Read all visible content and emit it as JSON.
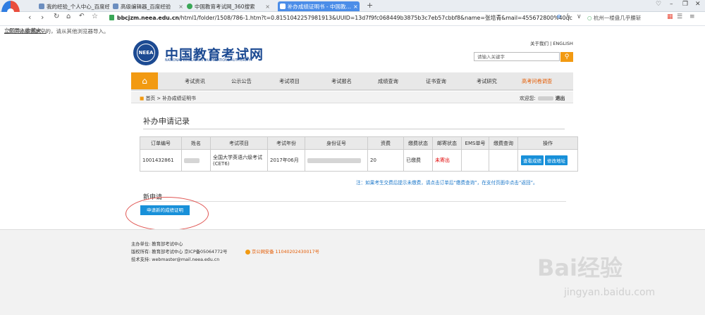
{
  "browser": {
    "tabs": [
      {
        "title": "我的经验_个人中心_百度经…",
        "active": false
      },
      {
        "title": "高级编辑器_百度经验",
        "active": false
      },
      {
        "title": "中国教育考试网_360搜索",
        "active": false
      },
      {
        "title": "补办成绩证明书 - 中国教…",
        "active": true
      }
    ],
    "url_host": "bbcjzm.neea.edu.cn",
    "url_rest": "/html1/folder/1508/786-1.htm?t=0.8151042257981913&UUID=13d7f9fc068449b3875b3c7eb57cbbf8&name=张培青&mail=455672800%40qc",
    "search_box": "杭州一楼盘几乎腰斩",
    "favbar_text": "您的收藏夹是空的，请从其他浏览器导入。",
    "favbar_link": "立即导入收藏夹..."
  },
  "site": {
    "toplinks": "关于我们 | ENGLISH",
    "logo_text": "NEEA",
    "name_cn": "中国教育考试网",
    "name_en": "NATIONAL EDUCATION EXAMINATIONS AUTHORITY",
    "search_placeholder": "请输入关键字",
    "nav": [
      "考试资讯",
      "公示公告",
      "考试项目",
      "考试报名",
      "成绩查询",
      "证书查询",
      "考试研究",
      "高考问卷调查"
    ],
    "breadcrumb": "首页 > 补办成绩证明书",
    "welcome": "欢迎您:",
    "logout": "退出"
  },
  "record": {
    "title": "补办申请记录",
    "headers": [
      "订单编号",
      "姓名",
      "考试项目",
      "考试年份",
      "身份证号",
      "资费",
      "缴费状态",
      "邮寄状态",
      "EMS单号",
      "缴费查询",
      "操作"
    ],
    "row": {
      "order": "1001432861",
      "exam": "全国大学英语六级考试(CET6)",
      "year": "2017年06月",
      "fee": "20",
      "pay_status": "已缴费",
      "mail_status": "未寄出",
      "btn_view": "查看成绩",
      "btn_edit": "修改地址"
    },
    "note": "注：如果考生交费后提示未缴费，请点击订单后“缴费查询”，在支付页面中点击“返回”。"
  },
  "new_request": {
    "title": "新申请",
    "button": "申请新的成绩证明"
  },
  "footer": {
    "host": "主办单位:   教育部考试中心",
    "copyright": "版权所有:   教育部考试中心        京ICP备05064772号",
    "police": "京公网安备 11040202430017号",
    "support": "技术支持:   webmaster@mail.neea.edu.cn"
  },
  "watermark": {
    "main": "Bai经验",
    "sub": "jingyan.baidu.com"
  },
  "colors": {
    "accent_orange": "#f29a12",
    "brand_blue": "#1c4a92",
    "button_blue": "#1890d9",
    "alert_red": "#e00000",
    "annotation_red": "#e05552"
  }
}
